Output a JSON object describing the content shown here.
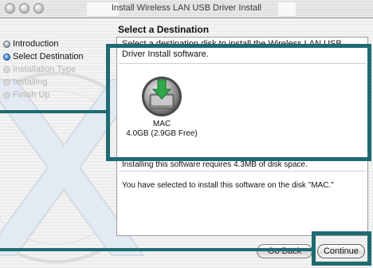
{
  "window": {
    "title": "Install Wireless LAN USB Driver Install"
  },
  "header": {
    "section_title": "Select a Destination"
  },
  "sidebar": {
    "steps": [
      {
        "label": "Introduction",
        "state": "done"
      },
      {
        "label": "Select Destination",
        "state": "current"
      },
      {
        "label": "Installation Type",
        "state": "pending"
      },
      {
        "label": "Installing",
        "state": "pending"
      },
      {
        "label": "Finish Up",
        "state": "pending"
      }
    ]
  },
  "main": {
    "description": "Select a destination disk to install the Wireless LAN USB Driver Install software.",
    "disks": [
      {
        "name": "MAC",
        "size": "4.0GB (2.9GB Free)",
        "icon": "hard-disk-install-icon"
      }
    ],
    "requirement_text": "Installing this software requires 4.3MB of disk space.",
    "selection_text": "You have selected to install this software on the disk \"MAC.\""
  },
  "buttons": {
    "back_label": "Go Back",
    "continue_label": "Continue"
  },
  "colors": {
    "highlight": "#1f6b73",
    "current_step": "#3f86d8",
    "install_arrow": "#2fa84a"
  }
}
